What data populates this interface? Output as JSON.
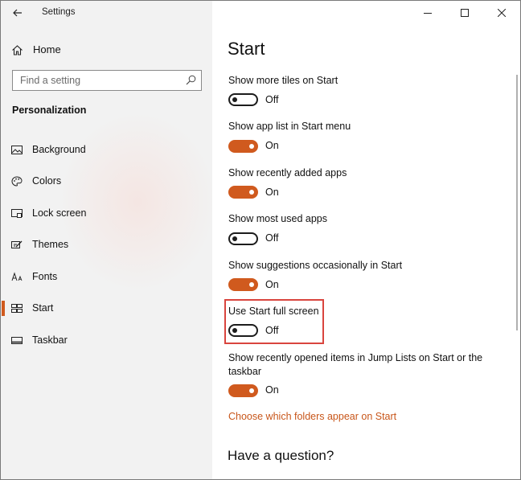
{
  "window": {
    "app_title": "Settings"
  },
  "sidebar": {
    "home_label": "Home",
    "search_placeholder": "Find a setting",
    "section_title": "Personalization",
    "items": [
      {
        "label": "Background",
        "icon": "picture-icon"
      },
      {
        "label": "Colors",
        "icon": "palette-icon"
      },
      {
        "label": "Lock screen",
        "icon": "lock-screen-icon"
      },
      {
        "label": "Themes",
        "icon": "themes-icon"
      },
      {
        "label": "Fonts",
        "icon": "fonts-icon"
      },
      {
        "label": "Start",
        "icon": "start-icon",
        "selected": true
      },
      {
        "label": "Taskbar",
        "icon": "taskbar-icon"
      }
    ]
  },
  "main": {
    "title": "Start",
    "settings": [
      {
        "label": "Show more tiles on Start",
        "state": "Off"
      },
      {
        "label": "Show app list in Start menu",
        "state": "On"
      },
      {
        "label": "Show recently added apps",
        "state": "On"
      },
      {
        "label": "Show most used apps",
        "state": "Off"
      },
      {
        "label": "Show suggestions occasionally in Start",
        "state": "On"
      },
      {
        "label": "Use Start full screen",
        "state": "Off"
      },
      {
        "label": "Show recently opened items in Jump Lists on Start or the taskbar",
        "state": "On"
      }
    ],
    "link": "Choose which folders appear on Start",
    "question_heading": "Have a question?"
  },
  "colors": {
    "accent": "#d05a1e",
    "link": "#c8561a",
    "highlight": "#d9453e"
  }
}
